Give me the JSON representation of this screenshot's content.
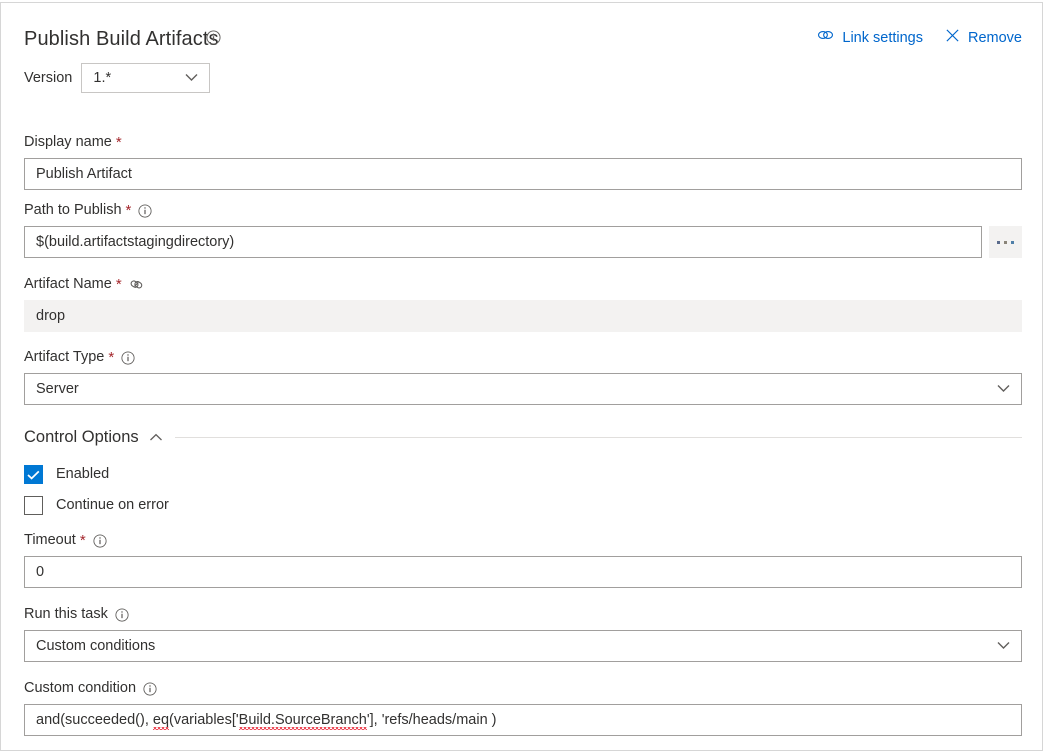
{
  "panel": {
    "title": "Publish Build Artifacts",
    "title_info_icon": "info-icon",
    "link_settings_label": "Link settings",
    "link_settings_icon": "chain-link-icon",
    "remove_label": "Remove",
    "remove_icon": "close-x-icon"
  },
  "version": {
    "label": "Version",
    "value": "1.*",
    "chevron_icon": "chevron-down-icon"
  },
  "fields": {
    "display_name": {
      "label": "Display name",
      "required": "*",
      "value": "Publish Artifact"
    },
    "path_to_publish": {
      "label": "Path to Publish",
      "required": "*",
      "info_icon": "info-icon",
      "value": "$(build.artifactstagingdirectory)",
      "browse_label": "..."
    },
    "artifact_name": {
      "label": "Artifact Name",
      "required": "*",
      "link_icon": "chain-link-icon",
      "value": "drop",
      "readonly": true
    },
    "artifact_type": {
      "label": "Artifact Type",
      "required": "*",
      "info_icon": "info-icon",
      "value": "Server",
      "chevron_icon": "chevron-down-icon"
    }
  },
  "control_options": {
    "title": "Control Options",
    "collapse_icon": "chevron-up-icon",
    "enabled": {
      "label": "Enabled",
      "checked": true,
      "check_icon": "checkmark-icon"
    },
    "continue_on_error": {
      "label": "Continue on error",
      "checked": false
    },
    "timeout": {
      "label": "Timeout",
      "required": "*",
      "info_icon": "info-icon",
      "value": "0"
    },
    "run_this_task": {
      "label": "Run this task",
      "info_icon": "info-icon",
      "value": "Custom conditions",
      "chevron_icon": "chevron-down-icon"
    },
    "custom_condition": {
      "label": "Custom condition",
      "info_icon": "info-icon",
      "value": "and(succeeded(), eq(variables['Build.SourceBranch'], 'refs/heads/main )",
      "segments": [
        {
          "text": "and(succeeded(), ",
          "misspelled": false
        },
        {
          "text": "eq",
          "misspelled": true
        },
        {
          "text": "(variables['",
          "misspelled": false
        },
        {
          "text": "Build.SourceBranch",
          "misspelled": true
        },
        {
          "text": "'], 'refs/heads/main )",
          "misspelled": false
        }
      ]
    }
  },
  "colors": {
    "accent": "#0078d4",
    "link": "#0066cc",
    "required_asterisk": "#a4262c",
    "text": "#323130",
    "border": "#a19f9d",
    "readonly_bg": "#f3f2f1",
    "spellcheck_underline": "#e81123"
  }
}
